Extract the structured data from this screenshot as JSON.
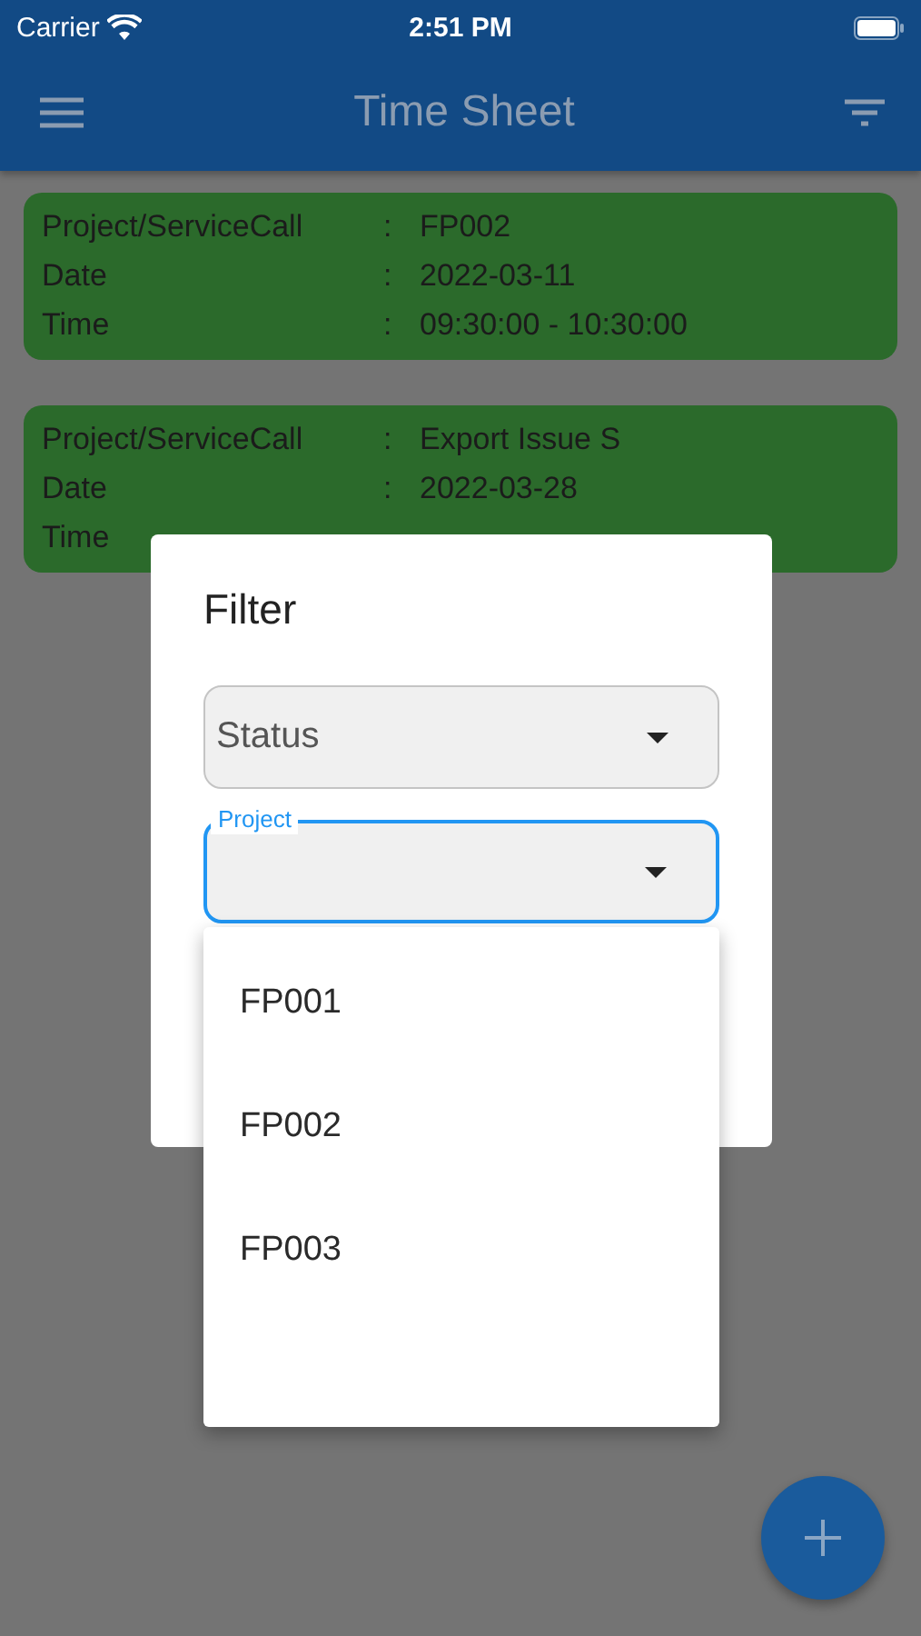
{
  "status_bar": {
    "carrier": "Carrier",
    "time": "2:51 PM"
  },
  "app_bar": {
    "title": "Time Sheet"
  },
  "entries": [
    {
      "rows": [
        {
          "label": "Project/ServiceCall",
          "separator": ":",
          "value": "FP002"
        },
        {
          "label": "Date",
          "separator": ":",
          "value": "2022-03-11"
        },
        {
          "label": "Time",
          "separator": ":",
          "value": "09:30:00 - 10:30:00"
        }
      ]
    },
    {
      "rows": [
        {
          "label": "Project/ServiceCall",
          "separator": ":",
          "value": "Export Issue S"
        },
        {
          "label": "Date",
          "separator": ":",
          "value": "2022-03-28"
        },
        {
          "label": "Time"
        }
      ]
    }
  ],
  "dialog": {
    "title": "Filter",
    "fields": [
      {
        "kind": "plain",
        "placeholder": "Status",
        "focused": false
      },
      {
        "kind": "outlined",
        "label": "Project",
        "focused": true
      }
    ]
  },
  "dropdown": {
    "options": [
      {
        "label": "FP001"
      },
      {
        "label": "FP002"
      },
      {
        "label": "FP003"
      }
    ]
  }
}
